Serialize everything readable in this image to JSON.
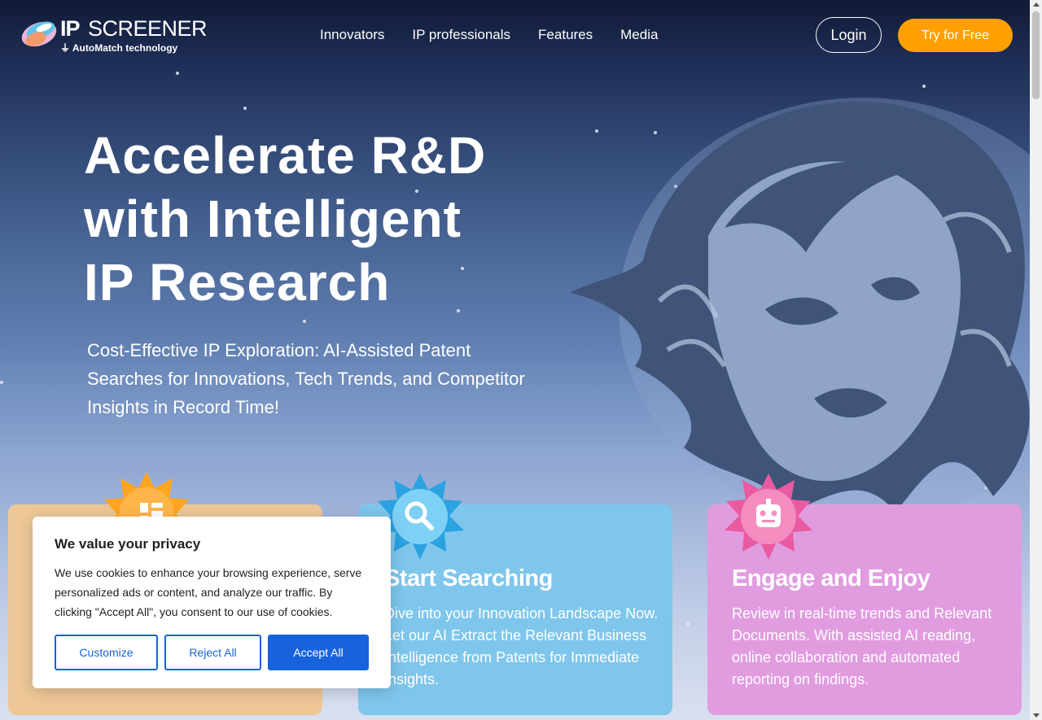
{
  "header": {
    "logo": {
      "brand_bold": "IP",
      "brand_light": "SCREENER",
      "tagline": "AutoMatch technology"
    },
    "nav": [
      "Innovators",
      "IP professionals",
      "Features",
      "Media"
    ],
    "login_label": "Login",
    "try_label": "Try for Free"
  },
  "hero": {
    "title_lines": [
      "Accelerate R&D",
      "with Intelligent",
      "IP Research"
    ],
    "subtitle": "Cost-Effective IP Exploration: AI-Assisted Patent Searches for Innovations, Tech Trends, and Competitor Insights in Record Time!"
  },
  "cards": [
    {
      "icon": "document-icon",
      "title": "",
      "text": "",
      "color": "#edc797"
    },
    {
      "icon": "search-icon",
      "title": "Start Searching",
      "text": "Dive into your Innovation Landscape Now. Let our AI Extract the Relevant Business Intelligence from Patents for Immediate Insights.",
      "color": "#7ec6ec"
    },
    {
      "icon": "robot-icon",
      "title": "Engage and Enjoy",
      "text": "Review in real-time trends and Relevant Documents. With assisted AI reading, online collaboration and automated reporting on findings.",
      "color": "#e19ce0"
    }
  ],
  "cookie_banner": {
    "title": "We value your privacy",
    "text": "We use cookies to enhance your browsing experience, serve personalized ads or content, and analyze our traffic. By clicking \"Accept All\", you consent to our use of cookies.",
    "customize_label": "Customize",
    "reject_label": "Reject All",
    "accept_label": "Accept All"
  },
  "colors": {
    "accent_orange": "#ffa000",
    "cookie_blue": "#1863dc",
    "hero_navy": "#111a36"
  }
}
